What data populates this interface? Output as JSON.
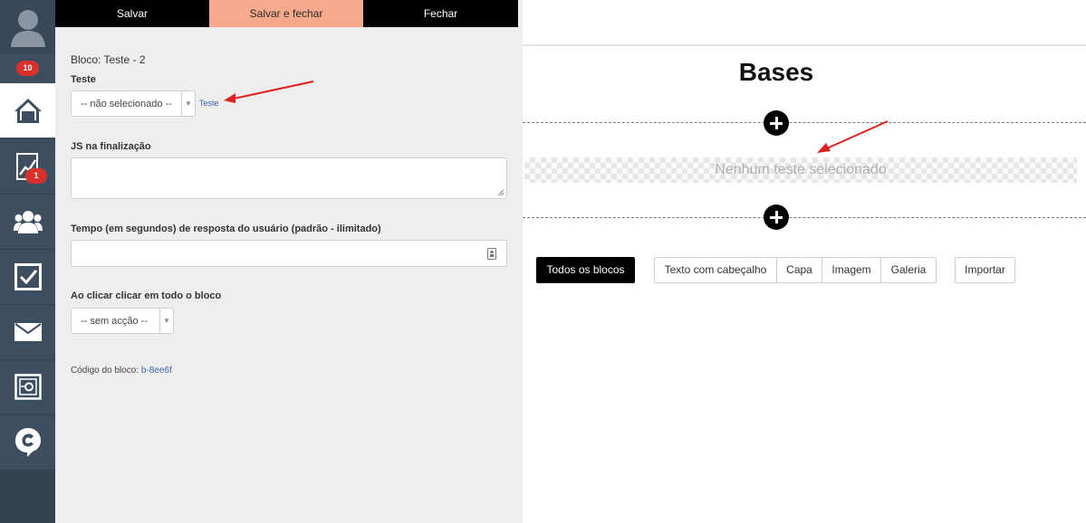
{
  "app": {
    "badges": {
      "notifications": "10",
      "reports": "1"
    },
    "nav_icons": [
      "user-icon",
      "home-icon",
      "chart-icon",
      "users-icon",
      "checkbox-icon",
      "mail-icon",
      "safe-icon",
      "chat-icon"
    ]
  },
  "toolbar": {
    "save_label": "Salvar",
    "save_close_label": "Salvar e fechar",
    "close_label": "Fechar"
  },
  "form": {
    "block_title": "Bloco: Teste - 2",
    "test_label": "Teste",
    "test_select_value": "-- não selecionado --",
    "test_link": "Teste",
    "js_label": "JS na finalização",
    "js_value": "",
    "time_label": "Tempo (em segundos) de resposta do usuário (padrão - ilimitado)",
    "time_value": "",
    "click_label": "Ao clicar clicar em todo o bloco",
    "click_select_value": "-- sem acção --",
    "code_label": "Código do bloco:",
    "code_value": "b-8ee6f"
  },
  "preview": {
    "title": "Bases",
    "empty_text": "Nenhum teste selecionado",
    "filters": [
      "Todos os blocos",
      "Texto com cabeçalho",
      "Capa",
      "Imagem",
      "Galeria"
    ],
    "import_label": "Importar"
  },
  "colors": {
    "accent": "#f7a98c",
    "rail": "#3d4e60",
    "badge": "#d9302b",
    "annotation": "#e0201c"
  }
}
